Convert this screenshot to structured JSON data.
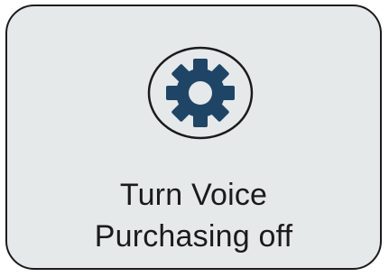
{
  "tile": {
    "label_line1": "Turn Voice",
    "label_line2": "Purchasing off",
    "icon": "gear-icon"
  },
  "colors": {
    "tile_background": "#e6e9ea",
    "border": "#1b1b1b",
    "gear": "#1f4566",
    "text": "#1b1b1b"
  }
}
